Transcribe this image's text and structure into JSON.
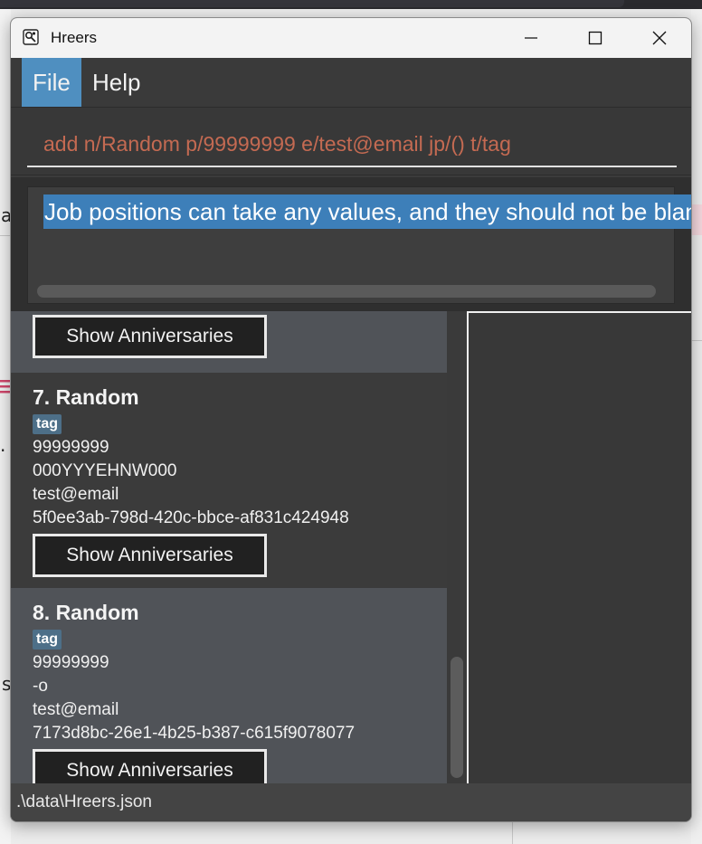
{
  "window": {
    "title": "Hreers"
  },
  "menu": {
    "file_label": "File",
    "help_label": "Help"
  },
  "command_box": {
    "value": "add n/Random p/99999999 e/test@email jp/() t/tag"
  },
  "result_display": {
    "message": "Job positions can take any values, and they should not be blank."
  },
  "persons": [
    {
      "partial": true,
      "button_label": "Show Anniversaries"
    },
    {
      "index_name": "7. Random",
      "tag": "tag",
      "phone": "99999999",
      "job_position": "000YYYEHNW000",
      "email": "test@email",
      "id": "5f0ee3ab-798d-420c-bbce-af831c424948",
      "button_label": "Show Anniversaries"
    },
    {
      "index_name": "8. Random",
      "tag": "tag",
      "phone": "99999999",
      "job_position": "-o",
      "email": "test@email",
      "id": "7173d8bc-26e1-4b25-b387-c615f9078077",
      "button_label": "Show Anniversaries"
    }
  ],
  "status_bar": {
    "file_path": ".\\data\\Hreers.json"
  },
  "background": {
    "fragments": [
      "a",
      ".",
      "s"
    ]
  },
  "colors": {
    "accent": "#4f8fc0",
    "command_text": "#c46a52",
    "tag_bg": "#4d6f88",
    "selection": "#3d7fb9"
  }
}
